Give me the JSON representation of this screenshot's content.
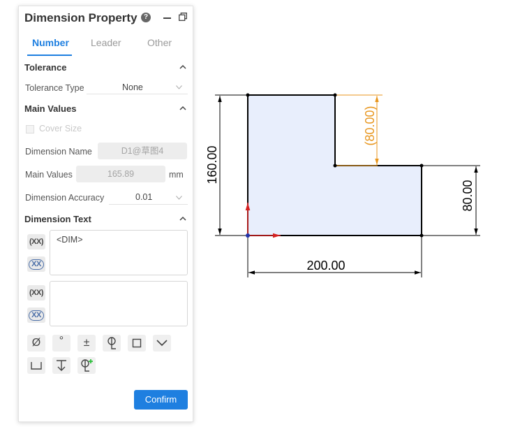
{
  "panel": {
    "title": "Dimension Property",
    "help_glyph": "?",
    "tabs": [
      "Number",
      "Leader",
      "Other"
    ],
    "tolerance": {
      "header": "Tolerance",
      "type_label": "Tolerance Type",
      "type_value": "None"
    },
    "main_values": {
      "header": "Main Values",
      "cover_size_label": "Cover Size",
      "dimension_name_label": "Dimension Name",
      "dimension_name_value": "D1@草图4",
      "main_values_label": "Main Values",
      "main_values_value": "165.89",
      "unit": "mm",
      "accuracy_label": "Dimension Accuracy",
      "accuracy_value": "0.01"
    },
    "dimension_text": {
      "header": "Dimension Text",
      "xx_label": "(XX)",
      "xx_circled_label": "XX",
      "text1": "<DIM>",
      "text2": ""
    },
    "symbols": [
      "Ø",
      "°",
      "±",
      "",
      "",
      ""
    ],
    "confirm_label": "Confirm"
  },
  "drawing": {
    "dims": [
      "160.00",
      "(80.00)",
      "80.00",
      "200.00"
    ],
    "fill_color": "#e8eefc",
    "ref_dim_color": "#e8961e",
    "axis_red": "#d42020",
    "axis_blue": "#2233aa"
  }
}
